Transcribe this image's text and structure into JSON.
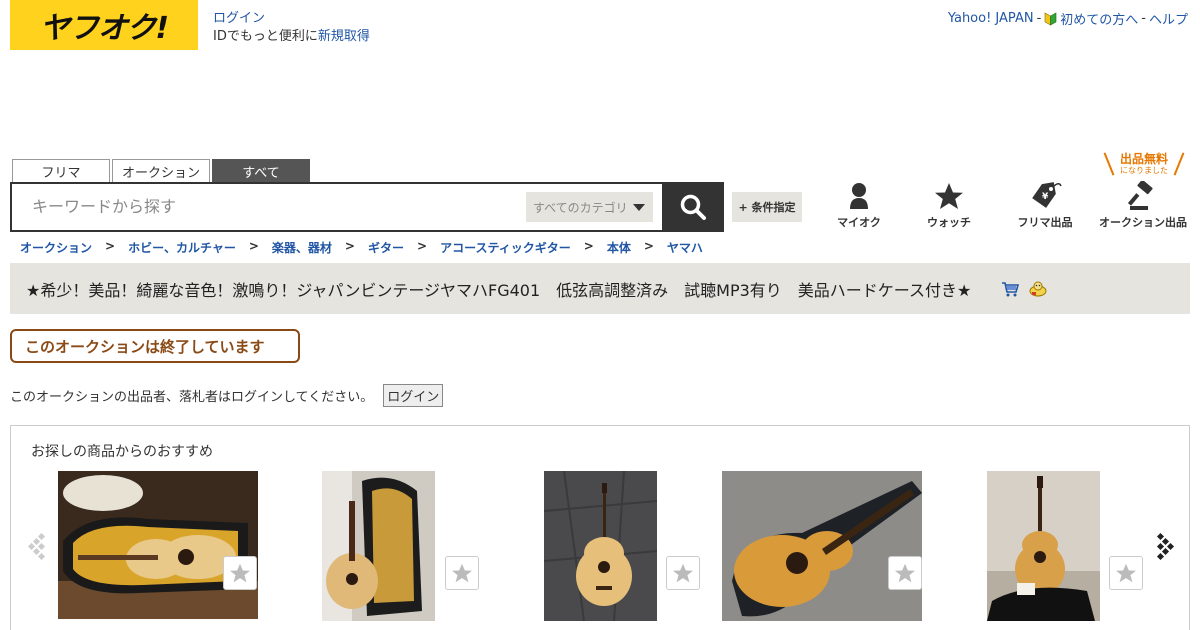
{
  "logo": {
    "text": "ヤフオク!"
  },
  "login": {
    "link": "ログイン",
    "line_prefix": "IDでもっと便利に",
    "register_link": "新規取得"
  },
  "header_links": {
    "yahoo_japan": "Yahoo! JAPAN",
    "sep1": "-",
    "first_time": "初めての方へ",
    "sep2": "-",
    "help": "ヘルプ"
  },
  "tabs": [
    {
      "label": "フリマ",
      "active": false
    },
    {
      "label": "オークション",
      "active": false
    },
    {
      "label": "すべて",
      "active": true
    }
  ],
  "search": {
    "placeholder": "キーワードから探す",
    "category": "すべてのカテゴリ",
    "conditions_button": "+ 条件指定"
  },
  "free_listing": {
    "line1": "出品無料",
    "line2": "になりました"
  },
  "nav": [
    {
      "label": "マイオク",
      "icon": "person-icon"
    },
    {
      "label": "ウォッチ",
      "icon": "star-icon"
    },
    {
      "label": "フリマ出品",
      "icon": "price-tag-icon"
    },
    {
      "label": "オークション出品",
      "icon": "gavel-icon"
    }
  ],
  "breadcrumb": [
    "オークション",
    "ホビー、カルチャー",
    "楽器、器材",
    "ギター",
    "アコースティックギター",
    "本体",
    "ヤマハ"
  ],
  "breadcrumb_separator": ">",
  "item": {
    "title": "★希少！美品！綺麗な音色！激鳴り！ジャパンビンテージヤマハFG401　低弦高調整済み　試聴MP3有り　美品ハードケース付き★",
    "icons": [
      "cart-icon",
      "seller-badge-icon"
    ]
  },
  "status": {
    "ended_label": "このオークションは終了しています"
  },
  "notice": {
    "text": "このオークションの出品者、落札者はログインしてください。",
    "login_button": "ログイン"
  },
  "recommend": {
    "heading": "お探しの商品からのおすすめ",
    "items": [
      {
        "icon": "guitar-in-case-photo"
      },
      {
        "icon": "guitar-with-case-photo"
      },
      {
        "icon": "guitar-on-ground-photo"
      },
      {
        "icon": "guitar-in-black-case-photo"
      },
      {
        "icon": "guitar-on-stand-photo"
      }
    ]
  },
  "colors": {
    "brand_yellow": "#ffd21d",
    "link_blue": "#2156a5",
    "ended_brown": "#8a4a16",
    "accent_orange": "#e67700"
  }
}
